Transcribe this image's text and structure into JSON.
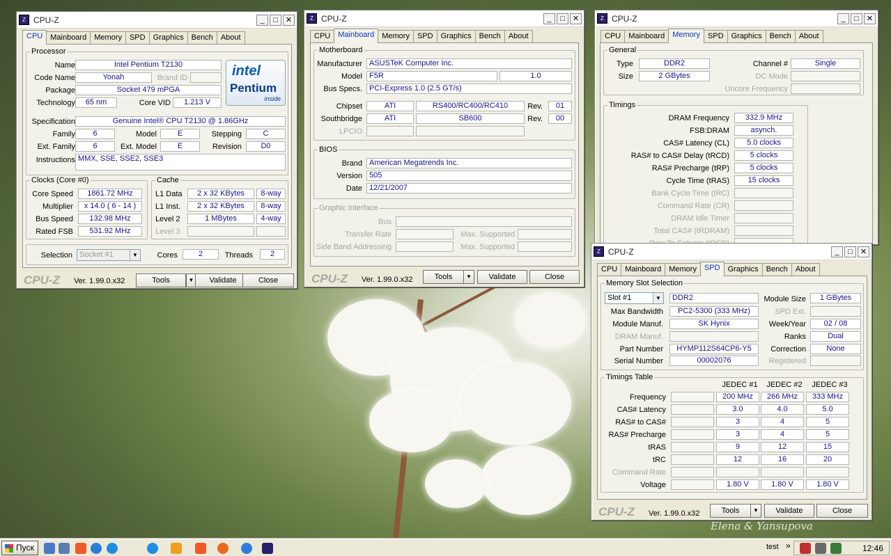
{
  "windows": [
    {
      "title": "CPU-Z",
      "active_tab": "CPU"
    },
    {
      "title": "CPU-Z",
      "active_tab": "Mainboard"
    },
    {
      "title": "CPU-Z",
      "active_tab": "Memory"
    },
    {
      "title": "CPU-Z",
      "active_tab": "SPD"
    }
  ],
  "tabs": [
    "CPU",
    "Mainboard",
    "Memory",
    "SPD",
    "Graphics",
    "Bench",
    "About"
  ],
  "common": {
    "brand": "CPU-Z",
    "version": "Ver. 1.99.0.x32",
    "tools": "Tools",
    "validate": "Validate",
    "close": "Close",
    "min": "_",
    "max": "□",
    "x": "✕"
  },
  "cpu": {
    "processor_title": "Processor",
    "name_label": "Name",
    "name": "Intel Pentium T2130",
    "code_name_label": "Code Name",
    "code_name": "Yonah",
    "brand_id_label": "Brand ID",
    "package_label": "Package",
    "package": "Socket 479 mPGA",
    "technology_label": "Technology",
    "technology": "65 nm",
    "core_vid_label": "Core VID",
    "core_vid": "1.213 V",
    "spec_label": "Specification",
    "spec": "Genuine Intel® CPU        T2130  @ 1.86GHz",
    "family_label": "Family",
    "family": "6",
    "model_label": "Model",
    "model": "E",
    "stepping_label": "Stepping",
    "stepping": "C",
    "ext_family_label": "Ext. Family",
    "ext_family": "6",
    "ext_model_label": "Ext. Model",
    "ext_model": "E",
    "revision_label": "Revision",
    "revision": "D0",
    "instr_label": "Instructions",
    "instr": "MMX, SSE, SSE2, SSE3",
    "clocks_title": "Clocks (Core #0)",
    "core_speed_label": "Core Speed",
    "core_speed": "1861.72 MHz",
    "multiplier_label": "Multiplier",
    "multiplier": "x 14.0 ( 6 - 14 )",
    "bus_speed_label": "Bus Speed",
    "bus_speed": "132.98 MHz",
    "rated_fsb_label": "Rated FSB",
    "rated_fsb": "531.92 MHz",
    "cache_title": "Cache",
    "l1d_label": "L1 Data",
    "l1d": "2 x 32 KBytes",
    "l1d_way": "8-way",
    "l1i_label": "L1 Inst.",
    "l1i": "2 x 32 KBytes",
    "l1i_way": "8-way",
    "l2_label": "Level 2",
    "l2": "1 MBytes",
    "l2_way": "4-way",
    "l3_label": "Level 3",
    "selection_label": "Selection",
    "selection": "Socket #1",
    "cores_label": "Cores",
    "cores": "2",
    "threads_label": "Threads",
    "threads": "2",
    "logo_intel": "intel",
    "logo_pentium": "Pentium",
    "logo_inside": "inside"
  },
  "mainboard": {
    "mb_title": "Motherboard",
    "manufacturer_label": "Manufacturer",
    "manufacturer": "ASUSTeK Computer Inc.",
    "model_label": "Model",
    "model": "F5R",
    "model_rev": "1.0",
    "bus_specs_label": "Bus Specs.",
    "bus_specs": "PCI-Express 1.0 (2.5 GT/s)",
    "chipset_label": "Chipset",
    "chipset_vendor": "ATI",
    "chipset": "RS400/RC400/RC410",
    "chipset_rev_label": "Rev.",
    "chipset_rev": "01",
    "southbridge_label": "Southbridge",
    "sb_vendor": "ATI",
    "sb": "SB600",
    "sb_rev_label": "Rev.",
    "sb_rev": "00",
    "lpcio_label": "LPCIO",
    "bios_title": "BIOS",
    "brand_label": "Brand",
    "brand": "American Megatrends Inc.",
    "version_label": "Version",
    "version": "505",
    "date_label": "Date",
    "date": "12/21/2007",
    "gi_title": "Graphic Interface",
    "bus_label": "Bus",
    "transfer_label": "Transfer Rate",
    "max_sup_label": "Max. Supported",
    "sba_label": "Side Band Addressing",
    "max_sup2_label": "Max. Supported"
  },
  "memory": {
    "general_title": "General",
    "type_label": "Type",
    "type": "DDR2",
    "channel_label": "Channel #",
    "channel": "Single",
    "size_label": "Size",
    "size": "2 GBytes",
    "dc_label": "DC Mode",
    "uncore_label": "Uncore Frequency",
    "timings_title": "Timings",
    "dram_freq_label": "DRAM Frequency",
    "dram_freq": "332.9 MHz",
    "fsb_dram_label": "FSB:DRAM",
    "fsb_dram": "asynch.",
    "cl_label": "CAS# Latency (CL)",
    "cl": "5.0 clocks",
    "trcd_label": "RAS# to CAS# Delay (tRCD)",
    "trcd": "5 clocks",
    "trp_label": "RAS# Precharge (tRP)",
    "trp": "5 clocks",
    "tras_label": "Cycle Time (tRAS)",
    "tras": "15 clocks",
    "trc_label": "Bank Cycle Time (tRC)",
    "cr_label": "Command Rate (CR)",
    "idle_label": "DRAM Idle Timer",
    "total_cas_label": "Total CAS# (tRDRAM)",
    "rtc_label": "Row To Column (tRCD)"
  },
  "spd": {
    "slot_title": "Memory Slot Selection",
    "slot": "Slot #1",
    "slot_type": "DDR2",
    "module_size_label": "Module Size",
    "module_size": "1 GBytes",
    "max_bw_label": "Max Bandwidth",
    "max_bw": "PC2-5300 (333 MHz)",
    "spd_ext_label": "SPD Ext.",
    "manuf_label": "Module Manuf.",
    "manuf": "SK Hynix",
    "week_label": "Week/Year",
    "week": "02 / 08",
    "dram_manuf_label": "DRAM Manuf.",
    "ranks_label": "Ranks",
    "ranks": "Dual",
    "part_label": "Part Number",
    "part": "HYMP112S64CP6-Y5",
    "correction_label": "Correction",
    "correction": "None",
    "serial_label": "Serial Number",
    "serial": "00002076",
    "registered_label": "Registered",
    "tt_title": "Timings Table",
    "cols": [
      "JEDEC #1",
      "JEDEC #2",
      "JEDEC #3"
    ],
    "rows": [
      {
        "label": "Frequency",
        "v": [
          "200 MHz",
          "266 MHz",
          "333 MHz"
        ],
        "dis": false
      },
      {
        "label": "CAS# Latency",
        "v": [
          "3.0",
          "4.0",
          "5.0"
        ],
        "dis": false
      },
      {
        "label": "RAS# to CAS#",
        "v": [
          "3",
          "4",
          "5"
        ],
        "dis": false
      },
      {
        "label": "RAS# Precharge",
        "v": [
          "3",
          "4",
          "5"
        ],
        "dis": false
      },
      {
        "label": "tRAS",
        "v": [
          "9",
          "12",
          "15"
        ],
        "dis": false
      },
      {
        "label": "tRC",
        "v": [
          "12",
          "16",
          "20"
        ],
        "dis": false
      },
      {
        "label": "Command Rate",
        "v": [
          "",
          "",
          ""
        ],
        "dis": true
      },
      {
        "label": "Voltage",
        "v": [
          "1.80 V",
          "1.80 V",
          "1.80 V"
        ],
        "dis": false
      }
    ]
  },
  "taskbar": {
    "start": "Пуск",
    "lang": "test",
    "lang_arrow": "»",
    "clock": "12:46"
  },
  "signature": "Elena & Yansupova"
}
